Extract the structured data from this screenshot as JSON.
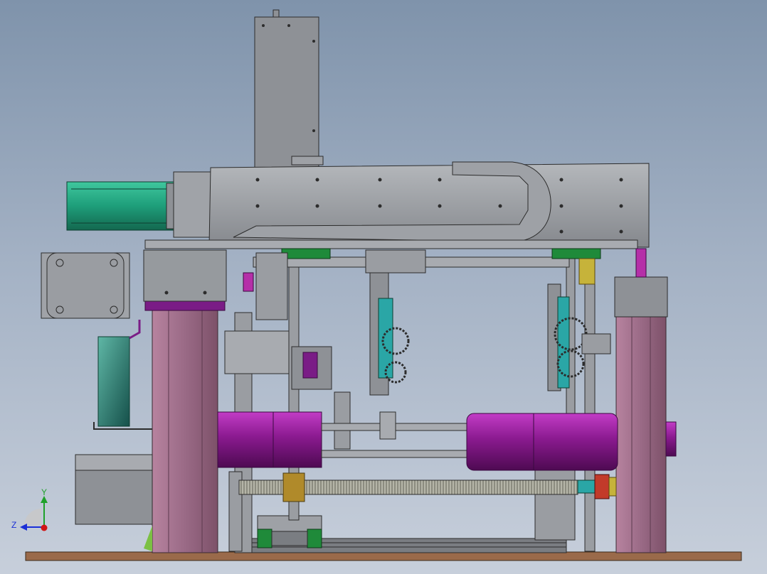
{
  "view": {
    "background_top": "#7f93ab",
    "background_bottom": "#c7cfdb"
  },
  "triad": {
    "y_label": "Y",
    "z_label": "Z",
    "y_color": "#1fa12a",
    "z_color": "#1b2fd6",
    "origin_color": "#d01515"
  },
  "colors": {
    "steel": "#8e9196",
    "steel_light": "#a8abb0",
    "steel_dark": "#5f6266",
    "motor_green": "#1e9e7a",
    "motor_purple": "#8a1a8f",
    "column_pink": "#9a6a86",
    "column_purple": "#7a1c86",
    "base_brown": "#9a6a4a",
    "block_green": "#1f8a3a",
    "gear_teal": "#2aa6a6",
    "brass": "#b08a2a",
    "lead_screw": "#9a9a8a"
  },
  "components": [
    "vertical-slide-plate",
    "horizontal-beam",
    "cable-drag-chain",
    "servo-motor-top",
    "stepper-motor-left",
    "left-column",
    "right-column",
    "left-spindle-motor",
    "right-spindle-motor",
    "lead-screw",
    "base-plate",
    "gear-train",
    "linear-rail"
  ]
}
